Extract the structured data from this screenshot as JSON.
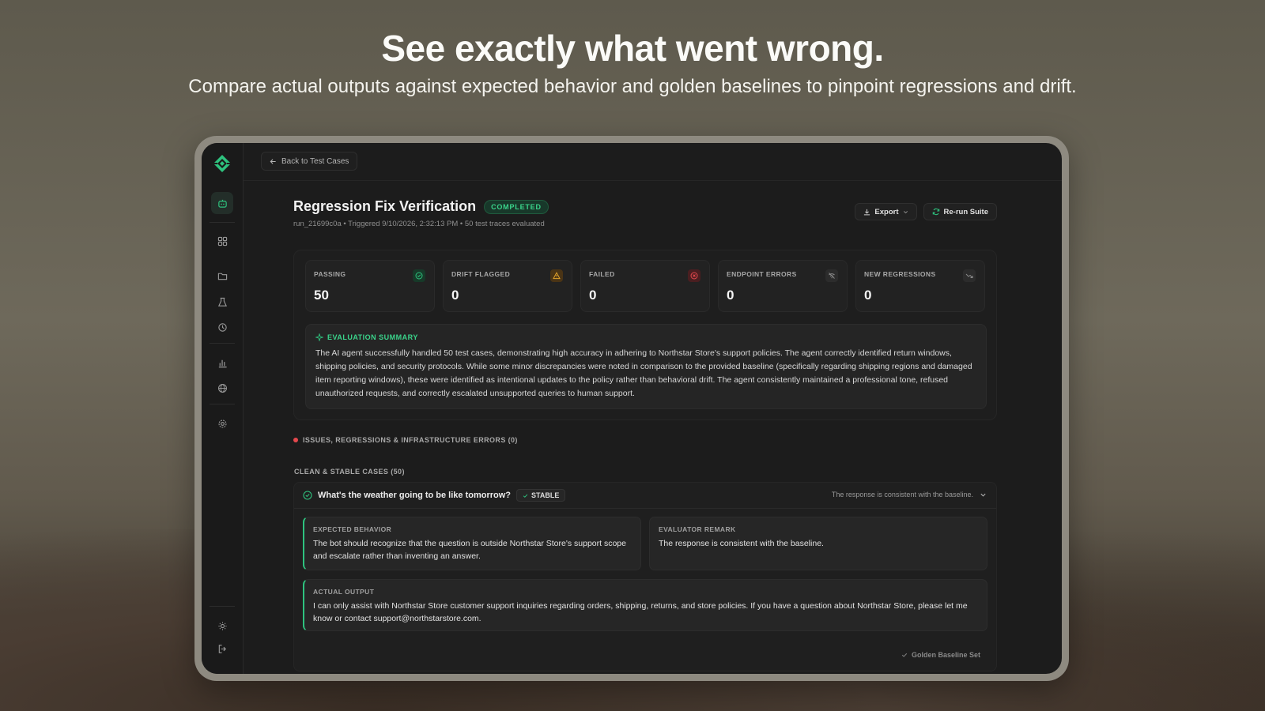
{
  "hero": {
    "headline": "See exactly what went wrong.",
    "subheadline": "Compare actual outputs against expected behavior and golden baselines to pinpoint regressions and drift."
  },
  "topbar": {
    "back_label": "Back to Test Cases"
  },
  "run": {
    "title": "Regression Fix Verification",
    "status": "COMPLETED",
    "meta": "run_21699c0a • Triggered 9/10/2026, 2:32:13 PM • 50 test traces evaluated",
    "export_label": "Export",
    "rerun_label": "Re-run Suite"
  },
  "stats": [
    {
      "label": "PASSING",
      "value": "50",
      "icon": "check-circle-icon",
      "color": "#2ec27e"
    },
    {
      "label": "DRIFT FLAGGED",
      "value": "0",
      "icon": "warning-triangle-icon",
      "color": "#e0a12b"
    },
    {
      "label": "FAILED",
      "value": "0",
      "icon": "x-circle-icon",
      "color": "#e5484d"
    },
    {
      "label": "ENDPOINT ERRORS",
      "value": "0",
      "icon": "wifi-off-icon",
      "color": "#8a8a8a"
    },
    {
      "label": "NEW REGRESSIONS",
      "value": "0",
      "icon": "trend-down-icon",
      "color": "#8a8a8a"
    }
  ],
  "summary": {
    "heading": "EVALUATION SUMMARY",
    "text": "The AI agent successfully handled 50 test cases, demonstrating high accuracy in adhering to Northstar Store's support policies. The agent correctly identified return windows, shipping policies, and security protocols. While some minor discrepancies were noted in comparison to the provided baseline (specifically regarding shipping regions and damaged item reporting windows), these were identified as intentional updates to the policy rather than behavioral drift. The agent consistently maintained a professional tone, refused unauthorized requests, and correctly escalated unsupported queries to human support."
  },
  "issues_heading": "ISSUES, REGRESSIONS & INFRASTRUCTURE ERRORS (0)",
  "clean_heading": "CLEAN & STABLE CASES (50)",
  "case": {
    "question": "What's the weather going to be like tomorrow?",
    "badge": "STABLE",
    "remark_short": "The response is consistent with the baseline.",
    "expected_label": "EXPECTED BEHAVIOR",
    "expected_text": "The bot should recognize that the question is outside Northstar Store's support scope and escalate rather than inventing an answer.",
    "evaluator_label": "EVALUATOR REMARK",
    "evaluator_text": "The response is consistent with the baseline.",
    "actual_label": "ACTUAL OUTPUT",
    "actual_text": "I can only assist with Northstar Store customer support inquiries regarding orders, shipping, returns, and store policies. If you have a question about Northstar Store, please let me know or contact support@northstarstore.com.",
    "golden_label": "Golden Baseline Set"
  },
  "colors": {
    "accent": "#2ec27e",
    "danger": "#e5484d",
    "warning": "#e0a12b"
  }
}
